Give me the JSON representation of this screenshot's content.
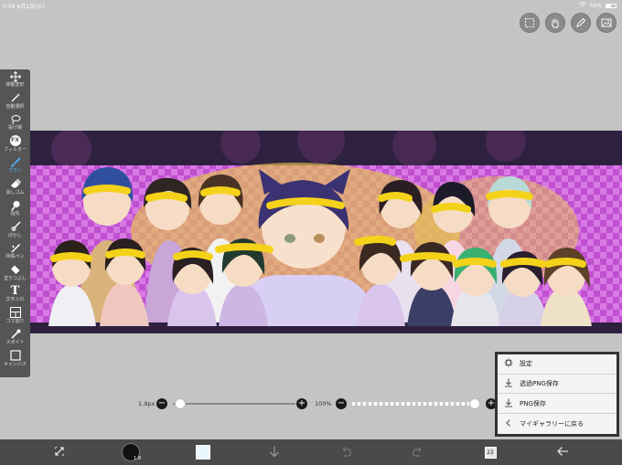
{
  "status": {
    "time": "0:59",
    "date": "6月1日(火)",
    "battery": "50%"
  },
  "tools": [
    {
      "label": "移動変形",
      "icon": "move-icon"
    },
    {
      "label": "自動選択",
      "icon": "magic-wand-icon"
    },
    {
      "label": "投げ縄",
      "icon": "lasso-icon"
    },
    {
      "label": "フィルター",
      "icon": "fx-icon",
      "glyph": "FX"
    },
    {
      "label": "ブラシ",
      "icon": "brush-icon",
      "active": true
    },
    {
      "label": "消しゴム",
      "icon": "eraser-icon"
    },
    {
      "label": "指先",
      "icon": "finger-icon"
    },
    {
      "label": "ぼかし",
      "icon": "blur-icon"
    },
    {
      "label": "特殊ペン",
      "icon": "special-pen-icon"
    },
    {
      "label": "塗りつぶし",
      "icon": "fill-bucket-icon"
    },
    {
      "label": "文字入れ",
      "icon": "text-icon",
      "glyph": "T"
    },
    {
      "label": "コマ割り",
      "icon": "frame-divider-icon"
    },
    {
      "label": "スポイト",
      "icon": "eyedropper-icon"
    },
    {
      "label": "キャンバス",
      "icon": "canvas-icon"
    }
  ],
  "sliders": {
    "size_label": "1.9px",
    "opacity_label": "100%"
  },
  "bottombar": {
    "brush_size": "1.9",
    "layer_count": "22"
  },
  "menu": {
    "items": [
      {
        "label": "設定",
        "icon": "gear-icon"
      },
      {
        "label": "透過PNG保存",
        "icon": "download-icon"
      },
      {
        "label": "PNG保存",
        "icon": "download-icon"
      },
      {
        "label": "マイギャラリーに戻る",
        "icon": "chevron-left-icon"
      }
    ]
  },
  "colors": {
    "accent": "#4fb7ff",
    "toolbar": "#555555",
    "canvas_magenta": "#c74fd6",
    "highlight_yellow": "#f4d21a"
  }
}
